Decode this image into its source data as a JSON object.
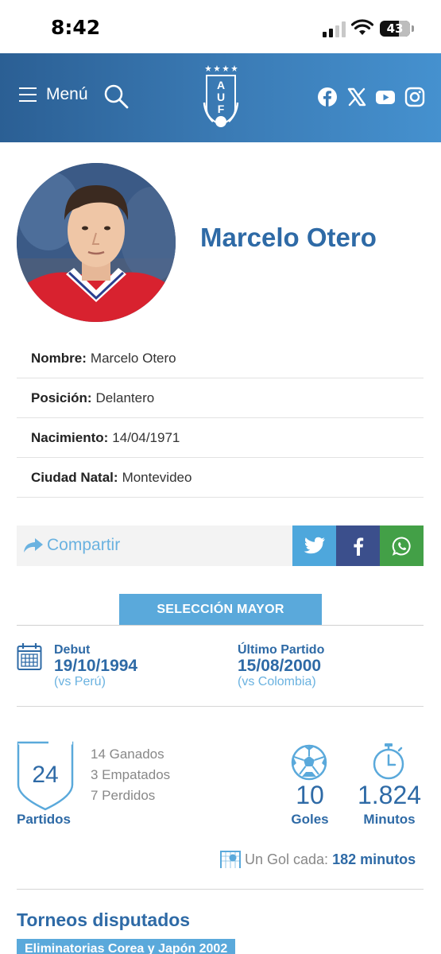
{
  "status_bar": {
    "time": "8:42",
    "battery": "43"
  },
  "header": {
    "menu_label": "Menú",
    "logo_text": "AUF",
    "social": [
      "facebook-icon",
      "x-icon",
      "youtube-icon",
      "instagram-icon"
    ]
  },
  "player": {
    "name": "Marcelo Otero",
    "info": [
      {
        "label": "Nombre:",
        "value": "Marcelo Otero"
      },
      {
        "label": "Posición:",
        "value": "Delantero"
      },
      {
        "label": "Nacimiento:",
        "value": "14/04/1971"
      },
      {
        "label": "Ciudad Natal:",
        "value": "Montevideo"
      }
    ]
  },
  "share": {
    "label": "Compartir",
    "colors": {
      "twitter": "#4ea7dc",
      "facebook": "#3b4f8c",
      "whatsapp": "#43a047"
    }
  },
  "section_tab": "SELECCIÓN MAYOR",
  "debut": {
    "title": "Debut",
    "date": "19/10/1994",
    "vs": "(vs Perú)"
  },
  "last_match": {
    "title": "Último Partido",
    "date": "15/08/2000",
    "vs": "(vs Colombia)"
  },
  "stats": {
    "partidos": "24",
    "partidos_label": "Partidos",
    "results": [
      "14 Ganados",
      "3 Empatados",
      "7 Perdidos"
    ],
    "goles": "10",
    "goles_label": "Goles",
    "minutos": "1.824",
    "minutos_label": "Minutos",
    "gol_cada_label": "Un Gol cada:",
    "gol_cada_value": "182 minutos"
  },
  "torneos": {
    "title": "Torneos disputados",
    "items": [
      "Eliminatorias Corea y Japón 2002"
    ]
  },
  "colors": {
    "brand_blue": "#2e6aa6",
    "accent_blue": "#5aa9db",
    "header_dark": "#2b5f94",
    "header_light": "#4591cf"
  }
}
